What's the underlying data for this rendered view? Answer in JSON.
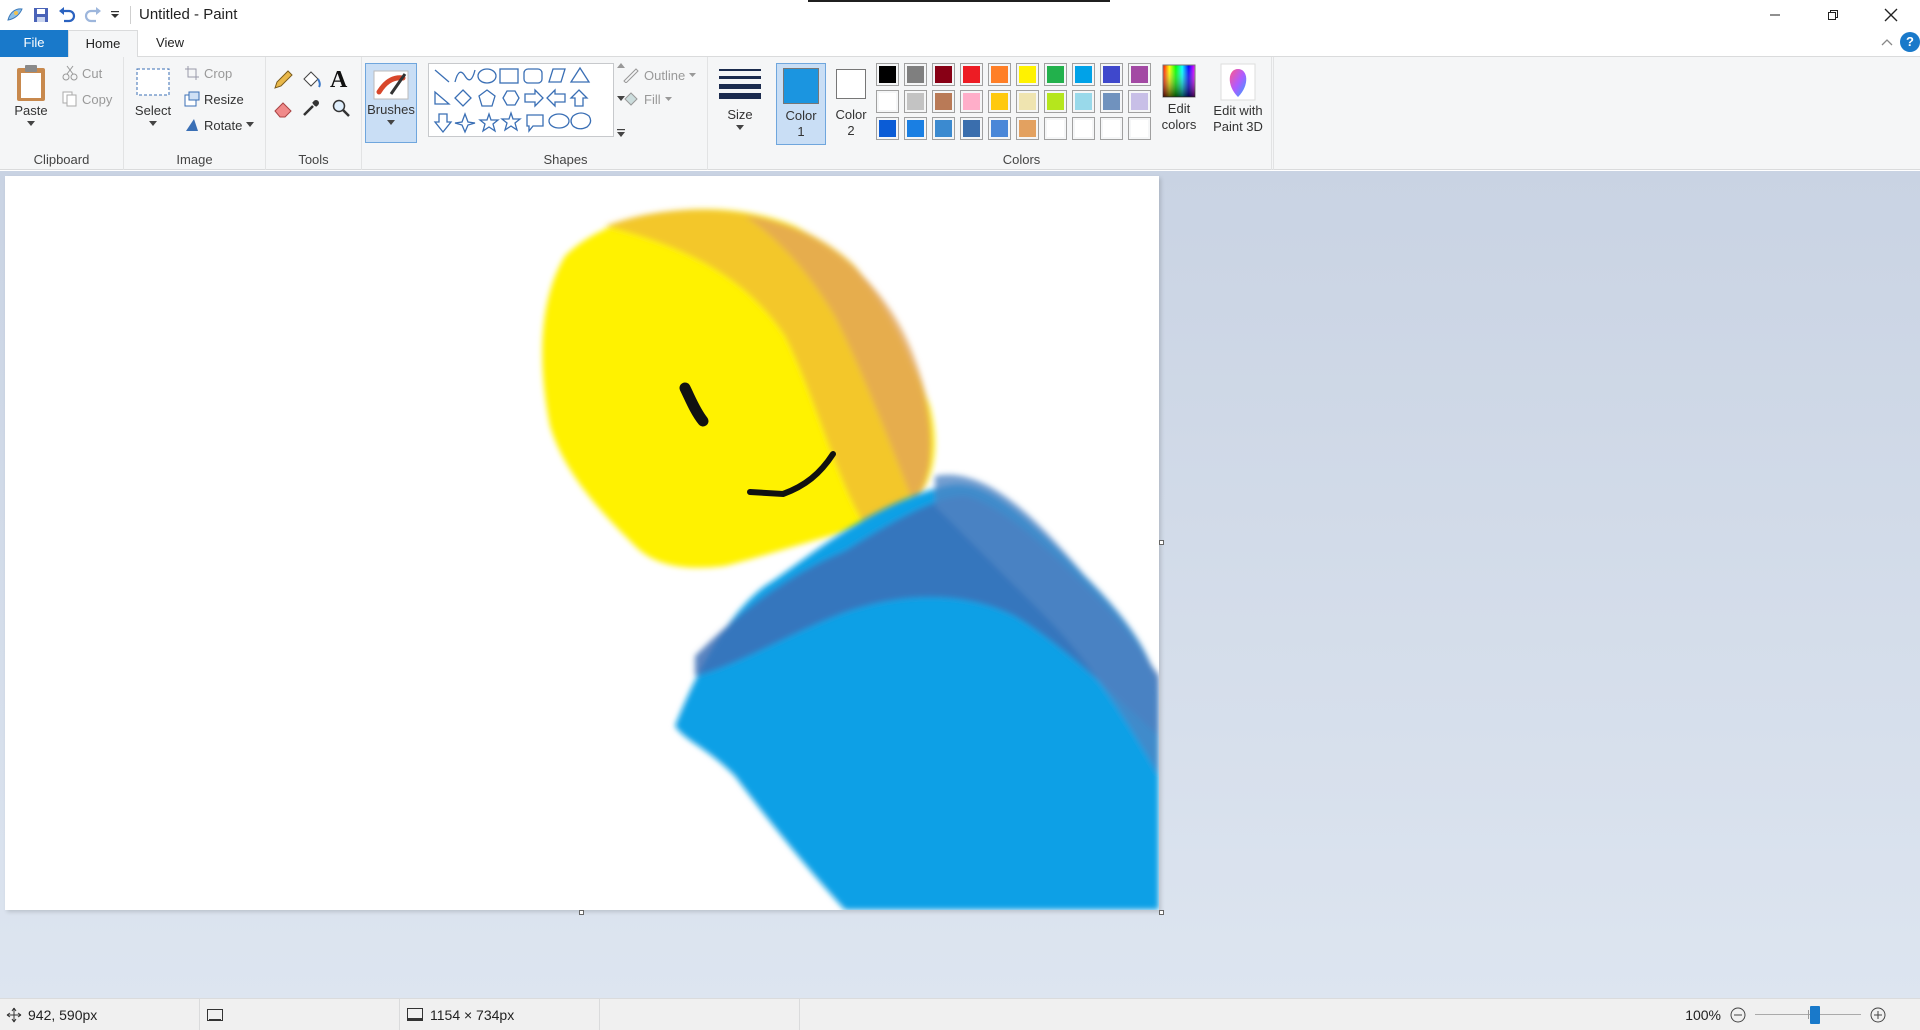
{
  "window": {
    "title": "Untitled - Paint"
  },
  "tabs": {
    "file": "File",
    "home": "Home",
    "view": "View"
  },
  "ribbon": {
    "clipboard": {
      "label": "Clipboard",
      "paste": "Paste",
      "cut": "Cut",
      "copy": "Copy"
    },
    "image": {
      "label": "Image",
      "select": "Select",
      "crop": "Crop",
      "resize": "Resize",
      "rotate": "Rotate"
    },
    "tools": {
      "label": "Tools"
    },
    "brushes": {
      "label": "Brushes"
    },
    "shapes": {
      "label": "Shapes",
      "outline": "Outline",
      "fill": "Fill"
    },
    "size": {
      "label": "Size"
    },
    "colors": {
      "label": "Colors",
      "color1_line1": "Color",
      "color1_line2": "1",
      "color2_line1": "Color",
      "color2_line2": "2",
      "edit_line1": "Edit",
      "edit_line2": "colors",
      "color1_value": "#1b95e0",
      "color2_value": "#ffffff",
      "palette": [
        "#000000",
        "#7f7f7f",
        "#880015",
        "#ed1c24",
        "#ff7f27",
        "#fff200",
        "#22b14c",
        "#00a2e8",
        "#3f48cc",
        "#a349a4",
        "#ffffff",
        "#c3c3c3",
        "#b97a57",
        "#ffaec9",
        "#ffc90e",
        "#efe4b0",
        "#b5e61d",
        "#99d9ea",
        "#7092be",
        "#c8bfe7",
        "#0b5cd6",
        "#1a7fe3",
        "#3b8ad0",
        "#3a6ead",
        "#4a87d8",
        "#e3a160",
        "#ffffff",
        "#ffffff",
        "#ffffff",
        "#ffffff"
      ]
    },
    "paint3d": {
      "line1": "Edit with",
      "line2": "Paint 3D"
    }
  },
  "status": {
    "cursor_pos": "942, 590px",
    "image_size": "1154 × 734px",
    "zoom": "100%",
    "zoom_level": 0.57
  }
}
